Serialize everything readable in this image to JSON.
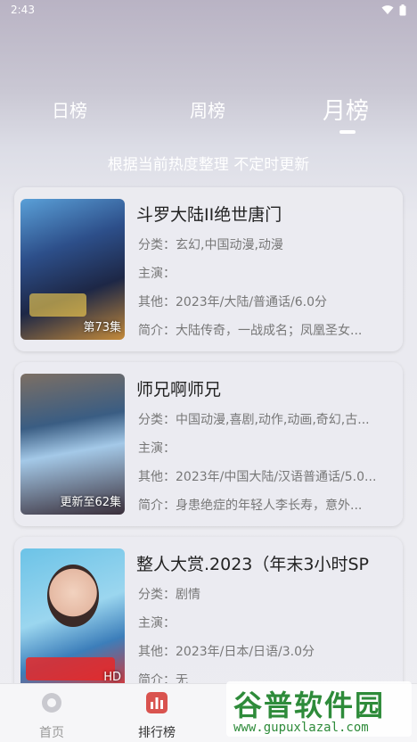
{
  "status": {
    "time": "2:43"
  },
  "tabs": [
    {
      "label": "日榜"
    },
    {
      "label": "周榜"
    },
    {
      "label": "月榜"
    }
  ],
  "subtitle": "根据当前热度整理 不定时更新",
  "items": [
    {
      "title": "斗罗大陆II绝世唐门",
      "badge": "第73集",
      "category": "分类：玄幻,中国动漫,动漫",
      "cast": "主演：",
      "other": "其他：2023年/大陆/普通话/6.0分",
      "intro": "简介：大陆传奇，一战成名；凤凰圣女..."
    },
    {
      "title": "师兄啊师兄",
      "badge": "更新至62集",
      "category": "分类：中国动漫,喜剧,动作,动画,奇幻,古...",
      "cast": "主演：",
      "other": "其他：2023年/中国大陆/汉语普通话/5.0...",
      "intro": "简介：身患绝症的年轻人李长寿，意外..."
    },
    {
      "title": "整人大赏.2023（年末3小时SP",
      "badge": "HD",
      "category": "分类：剧情",
      "cast": "主演：",
      "other": "其他：2023年/日本/日语/3.0分",
      "intro": "简介：无"
    }
  ],
  "nav": [
    {
      "label": "首页",
      "icon": "home-icon"
    },
    {
      "label": "排行榜",
      "icon": "ranking-icon"
    }
  ],
  "watermark": {
    "title": "谷普软件园",
    "url": "www.gupuxlazal.com"
  }
}
